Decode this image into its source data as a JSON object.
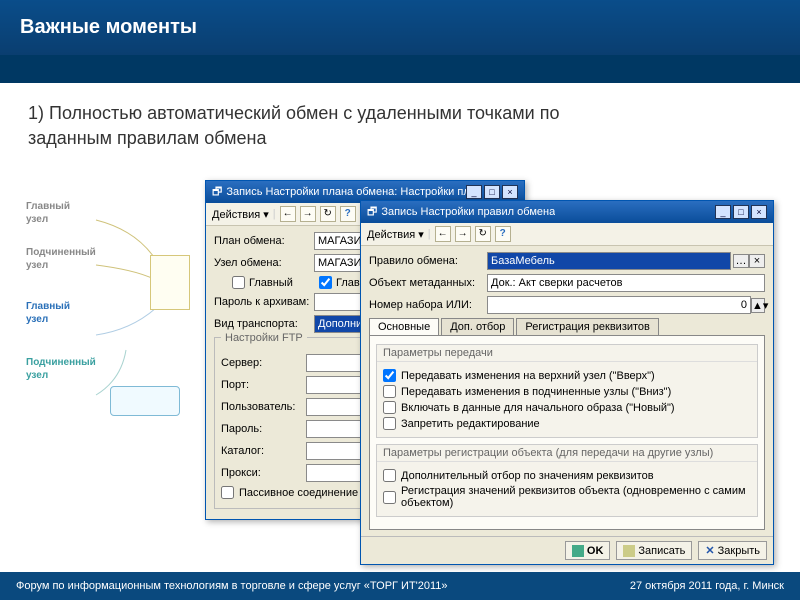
{
  "header": {
    "title": "Важные моменты"
  },
  "content": {
    "point1": "1) Полностью автоматический обмен с удаленными точками по заданным правилам обмена"
  },
  "diagram": {
    "n1": "Главный\nузел",
    "n2": "Подчиненный\nузел",
    "n3": "Главный\nузел",
    "n4": "Подчиненный\nузел"
  },
  "win1": {
    "title": "Запись Настройки плана обмена: Настройки пл...  *",
    "actions": "Действия ▾",
    "labels": {
      "plan": "План обмена:",
      "node": "Узел обмена:",
      "main": "Главный",
      "archive_pwd": "Пароль к архивам:",
      "transport": "Вид транспорта:"
    },
    "values": {
      "plan": "МАГАЗИНЗ",
      "node": "МАГАЗИНЗ",
      "main_checked": true,
      "transport": "Дополнительный тр"
    },
    "ftp_legend": "Настройки FTP",
    "ftp": {
      "server": "Сервер:",
      "port": "Порт:",
      "user": "Пользователь:",
      "pass": "Пароль:",
      "catalog": "Каталог:",
      "proxy": "Прокси:",
      "passive": "Пассивное соединение"
    }
  },
  "win2": {
    "title": "Запись Настройки правил обмена",
    "actions": "Действия ▾",
    "labels": {
      "rule": "Правило обмена:",
      "meta": "Объект метаданных:",
      "set": "Номер набора ИЛИ:"
    },
    "values": {
      "rule": "БазаМебель",
      "meta": "Док.: Акт сверки расчетов",
      "set": "0"
    },
    "tabs": [
      "Основные",
      "Доп. отбор",
      "Регистрация реквизитов"
    ],
    "group1": {
      "title": "Параметры передачи",
      "cb1": "Передавать изменения на верхний узел (\"Вверх\")",
      "cb2": "Передавать изменения в подчиненные узлы (\"Вниз\")",
      "cb3": "Включать в данные для начального образа (\"Новый\")",
      "cb4": "Запретить редактирование",
      "checked": [
        true,
        false,
        false,
        false
      ]
    },
    "group2": {
      "title": "Параметры регистрации объекта (для передачи на другие узлы)",
      "cb1": "Дополнительный отбор по значениям реквизитов",
      "cb2": "Регистрация значений реквизитов объекта (одновременно с самим объектом)"
    },
    "buttons": {
      "ok": "OK",
      "save": "Записать",
      "close": "Закрыть"
    }
  },
  "footer": {
    "left": "Форум по информационным технологиям в торговле и сфере услуг  «ТОРГ ИТ'2011»",
    "right": "27 октября 2011 года, г. Минск"
  }
}
